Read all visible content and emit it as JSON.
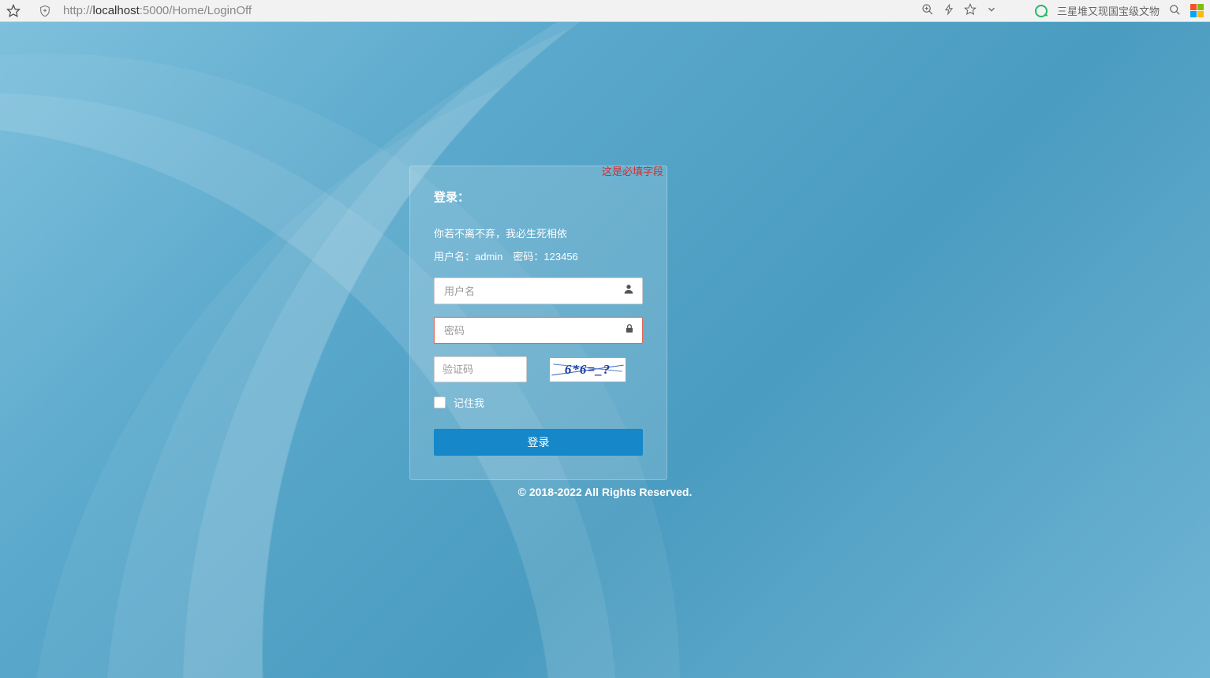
{
  "browser": {
    "url_prefix": "http://",
    "url_host": "localhost",
    "url_suffix": ":5000/Home/LoginOff",
    "news_text": "三星堆又现国宝级文物"
  },
  "login": {
    "required_msg": "这是必填字段",
    "title": "登录：",
    "subtitle1": "你若不离不弃，我必生死相依",
    "subtitle2": "用户名：admin 密码：123456",
    "username_placeholder": "用户名",
    "password_placeholder": "密码",
    "captcha_placeholder": "验证码",
    "captcha_text": "6*6=_?",
    "remember_label": "记住我",
    "button_label": "登录"
  },
  "footer": {
    "copyright": "© 2018-2022 All Rights Reserved."
  }
}
